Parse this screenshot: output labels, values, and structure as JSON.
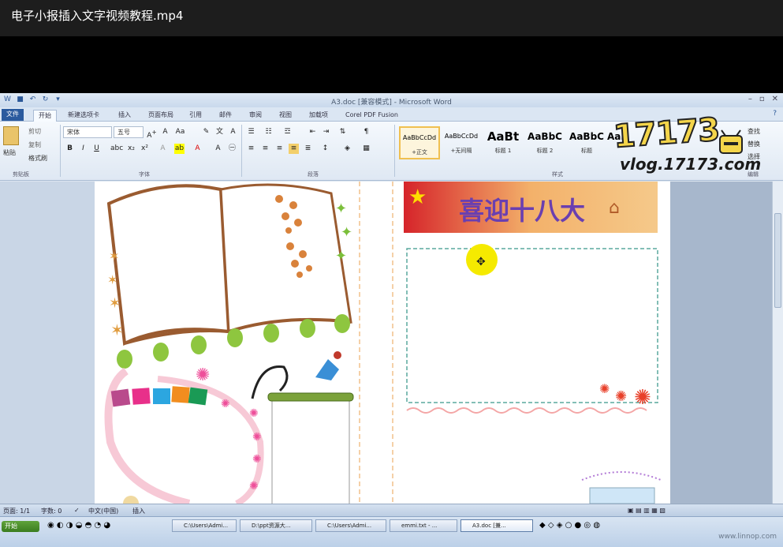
{
  "player": {
    "title": "电子小报插入文字视频教程.mp4"
  },
  "word": {
    "title": "A3.doc [兼容模式] - Microsoft Word",
    "tabs": [
      "文件",
      "开始",
      "新建选项卡",
      "插入",
      "页面布局",
      "引用",
      "邮件",
      "审阅",
      "视图",
      "加载项",
      "Corel PDF Fusion"
    ],
    "clipboard": {
      "paste": "粘贴",
      "cut": "剪切",
      "copy": "复制",
      "format_painter": "格式刷",
      "label": "剪贴板"
    },
    "font": {
      "name": "宋体",
      "size": "五号",
      "label": "字体"
    },
    "paragraph_label": "段落",
    "styles": {
      "label": "样式",
      "items": [
        {
          "preview": "AaBbCcDd",
          "name": "+正文"
        },
        {
          "preview": "AaBbCcDd",
          "name": "+无间隔"
        },
        {
          "preview": "AaBt",
          "name": "标题 1"
        },
        {
          "preview": "AaBbC",
          "name": "标题 2"
        },
        {
          "preview": "AaBbC",
          "name": "标题"
        },
        {
          "preview": "AaBl",
          "name": ""
        }
      ]
    },
    "editing": {
      "find": "查找",
      "replace": "替换",
      "select": "选择",
      "label": "编辑"
    }
  },
  "logo": {
    "number": "17173",
    "url": "vlog.17173.com"
  },
  "document": {
    "banner_text": "喜迎十八大"
  },
  "statusbar": {
    "page": "页面: 1/1",
    "words": "字数: 0",
    "language": "中文(中国)",
    "mode": "插入"
  },
  "taskbar": {
    "start": "开始",
    "items": [
      "C:\\Users\\Admi...",
      "D:\\ppt资源大...",
      "C:\\Users\\Admi...",
      "emmi.txt - ...",
      "A3.doc [兼...",
      ""
    ],
    "watermark": "www.linnop.com"
  }
}
